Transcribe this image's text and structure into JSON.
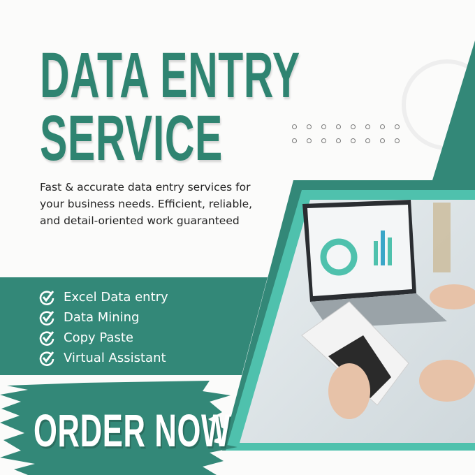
{
  "headline": {
    "line1": "DATA ENTRY",
    "line2": "SERVICE"
  },
  "description": "Fast & accurate data entry services for your business needs. Efficient, reliable, and detail-oriented work guaranteed",
  "features": [
    {
      "label": "Excel Data entry",
      "icon": "check-circle-icon"
    },
    {
      "label": "Data Mining",
      "icon": "check-circle-icon"
    },
    {
      "label": "Copy Paste",
      "icon": "check-circle-icon"
    },
    {
      "label": "Virtual Assistant",
      "icon": "check-circle-icon"
    }
  ],
  "cta": {
    "label": "ORDER NOW"
  },
  "colors": {
    "primary": "#338878",
    "accent": "#4fc1ad",
    "text": "#222222"
  }
}
